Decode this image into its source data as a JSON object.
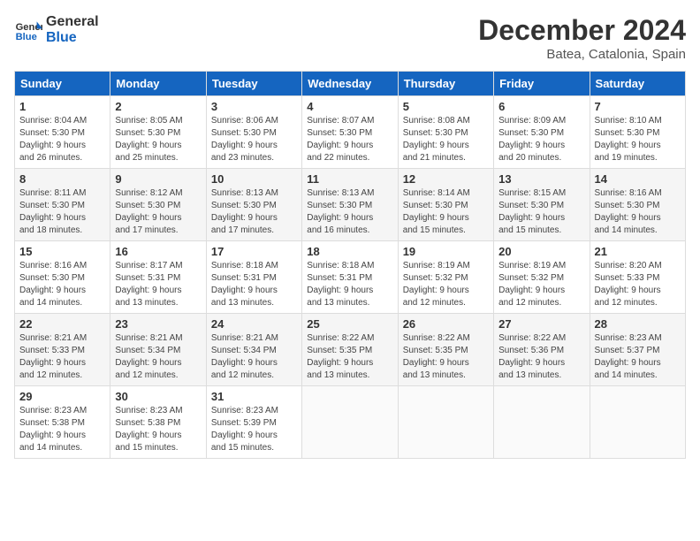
{
  "header": {
    "logo_line1": "General",
    "logo_line2": "Blue",
    "month": "December 2024",
    "location": "Batea, Catalonia, Spain"
  },
  "weekdays": [
    "Sunday",
    "Monday",
    "Tuesday",
    "Wednesday",
    "Thursday",
    "Friday",
    "Saturday"
  ],
  "weeks": [
    [
      {
        "day": "1",
        "info": "Sunrise: 8:04 AM\nSunset: 5:30 PM\nDaylight: 9 hours\nand 26 minutes."
      },
      {
        "day": "2",
        "info": "Sunrise: 8:05 AM\nSunset: 5:30 PM\nDaylight: 9 hours\nand 25 minutes."
      },
      {
        "day": "3",
        "info": "Sunrise: 8:06 AM\nSunset: 5:30 PM\nDaylight: 9 hours\nand 23 minutes."
      },
      {
        "day": "4",
        "info": "Sunrise: 8:07 AM\nSunset: 5:30 PM\nDaylight: 9 hours\nand 22 minutes."
      },
      {
        "day": "5",
        "info": "Sunrise: 8:08 AM\nSunset: 5:30 PM\nDaylight: 9 hours\nand 21 minutes."
      },
      {
        "day": "6",
        "info": "Sunrise: 8:09 AM\nSunset: 5:30 PM\nDaylight: 9 hours\nand 20 minutes."
      },
      {
        "day": "7",
        "info": "Sunrise: 8:10 AM\nSunset: 5:30 PM\nDaylight: 9 hours\nand 19 minutes."
      }
    ],
    [
      {
        "day": "8",
        "info": "Sunrise: 8:11 AM\nSunset: 5:30 PM\nDaylight: 9 hours\nand 18 minutes."
      },
      {
        "day": "9",
        "info": "Sunrise: 8:12 AM\nSunset: 5:30 PM\nDaylight: 9 hours\nand 17 minutes."
      },
      {
        "day": "10",
        "info": "Sunrise: 8:13 AM\nSunset: 5:30 PM\nDaylight: 9 hours\nand 17 minutes."
      },
      {
        "day": "11",
        "info": "Sunrise: 8:13 AM\nSunset: 5:30 PM\nDaylight: 9 hours\nand 16 minutes."
      },
      {
        "day": "12",
        "info": "Sunrise: 8:14 AM\nSunset: 5:30 PM\nDaylight: 9 hours\nand 15 minutes."
      },
      {
        "day": "13",
        "info": "Sunrise: 8:15 AM\nSunset: 5:30 PM\nDaylight: 9 hours\nand 15 minutes."
      },
      {
        "day": "14",
        "info": "Sunrise: 8:16 AM\nSunset: 5:30 PM\nDaylight: 9 hours\nand 14 minutes."
      }
    ],
    [
      {
        "day": "15",
        "info": "Sunrise: 8:16 AM\nSunset: 5:30 PM\nDaylight: 9 hours\nand 14 minutes."
      },
      {
        "day": "16",
        "info": "Sunrise: 8:17 AM\nSunset: 5:31 PM\nDaylight: 9 hours\nand 13 minutes."
      },
      {
        "day": "17",
        "info": "Sunrise: 8:18 AM\nSunset: 5:31 PM\nDaylight: 9 hours\nand 13 minutes."
      },
      {
        "day": "18",
        "info": "Sunrise: 8:18 AM\nSunset: 5:31 PM\nDaylight: 9 hours\nand 13 minutes."
      },
      {
        "day": "19",
        "info": "Sunrise: 8:19 AM\nSunset: 5:32 PM\nDaylight: 9 hours\nand 12 minutes."
      },
      {
        "day": "20",
        "info": "Sunrise: 8:19 AM\nSunset: 5:32 PM\nDaylight: 9 hours\nand 12 minutes."
      },
      {
        "day": "21",
        "info": "Sunrise: 8:20 AM\nSunset: 5:33 PM\nDaylight: 9 hours\nand 12 minutes."
      }
    ],
    [
      {
        "day": "22",
        "info": "Sunrise: 8:21 AM\nSunset: 5:33 PM\nDaylight: 9 hours\nand 12 minutes."
      },
      {
        "day": "23",
        "info": "Sunrise: 8:21 AM\nSunset: 5:34 PM\nDaylight: 9 hours\nand 12 minutes."
      },
      {
        "day": "24",
        "info": "Sunrise: 8:21 AM\nSunset: 5:34 PM\nDaylight: 9 hours\nand 12 minutes."
      },
      {
        "day": "25",
        "info": "Sunrise: 8:22 AM\nSunset: 5:35 PM\nDaylight: 9 hours\nand 13 minutes."
      },
      {
        "day": "26",
        "info": "Sunrise: 8:22 AM\nSunset: 5:35 PM\nDaylight: 9 hours\nand 13 minutes."
      },
      {
        "day": "27",
        "info": "Sunrise: 8:22 AM\nSunset: 5:36 PM\nDaylight: 9 hours\nand 13 minutes."
      },
      {
        "day": "28",
        "info": "Sunrise: 8:23 AM\nSunset: 5:37 PM\nDaylight: 9 hours\nand 14 minutes."
      }
    ],
    [
      {
        "day": "29",
        "info": "Sunrise: 8:23 AM\nSunset: 5:38 PM\nDaylight: 9 hours\nand 14 minutes."
      },
      {
        "day": "30",
        "info": "Sunrise: 8:23 AM\nSunset: 5:38 PM\nDaylight: 9 hours\nand 15 minutes."
      },
      {
        "day": "31",
        "info": "Sunrise: 8:23 AM\nSunset: 5:39 PM\nDaylight: 9 hours\nand 15 minutes."
      },
      null,
      null,
      null,
      null
    ]
  ]
}
